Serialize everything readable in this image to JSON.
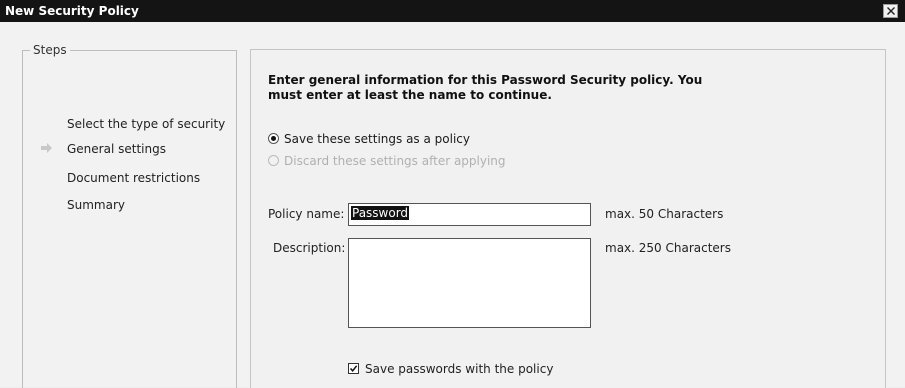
{
  "window": {
    "title": "New Security Policy",
    "close_icon": "close-icon"
  },
  "steps": {
    "legend": "Steps",
    "items": [
      {
        "label": "Select the type of security",
        "current": false
      },
      {
        "label": "General settings",
        "current": true
      },
      {
        "label": "Document restrictions",
        "current": false
      },
      {
        "label": "Summary",
        "current": false
      }
    ],
    "current_marker_icon": "arrow-right-icon"
  },
  "main": {
    "intro": "Enter general information for this Password Security policy. You must enter at least the name to continue.",
    "options": [
      {
        "label": "Save these settings as a policy",
        "selected": true,
        "enabled": true
      },
      {
        "label": "Discard these settings after applying",
        "selected": false,
        "enabled": false
      }
    ],
    "policy_name": {
      "label": "Policy name:",
      "value": "Password",
      "hint": "max. 50 Characters"
    },
    "description": {
      "label": "Description:",
      "value": "",
      "hint": "max. 250 Characters"
    },
    "save_passwords": {
      "label": "Save passwords with the policy",
      "checked": true
    }
  }
}
